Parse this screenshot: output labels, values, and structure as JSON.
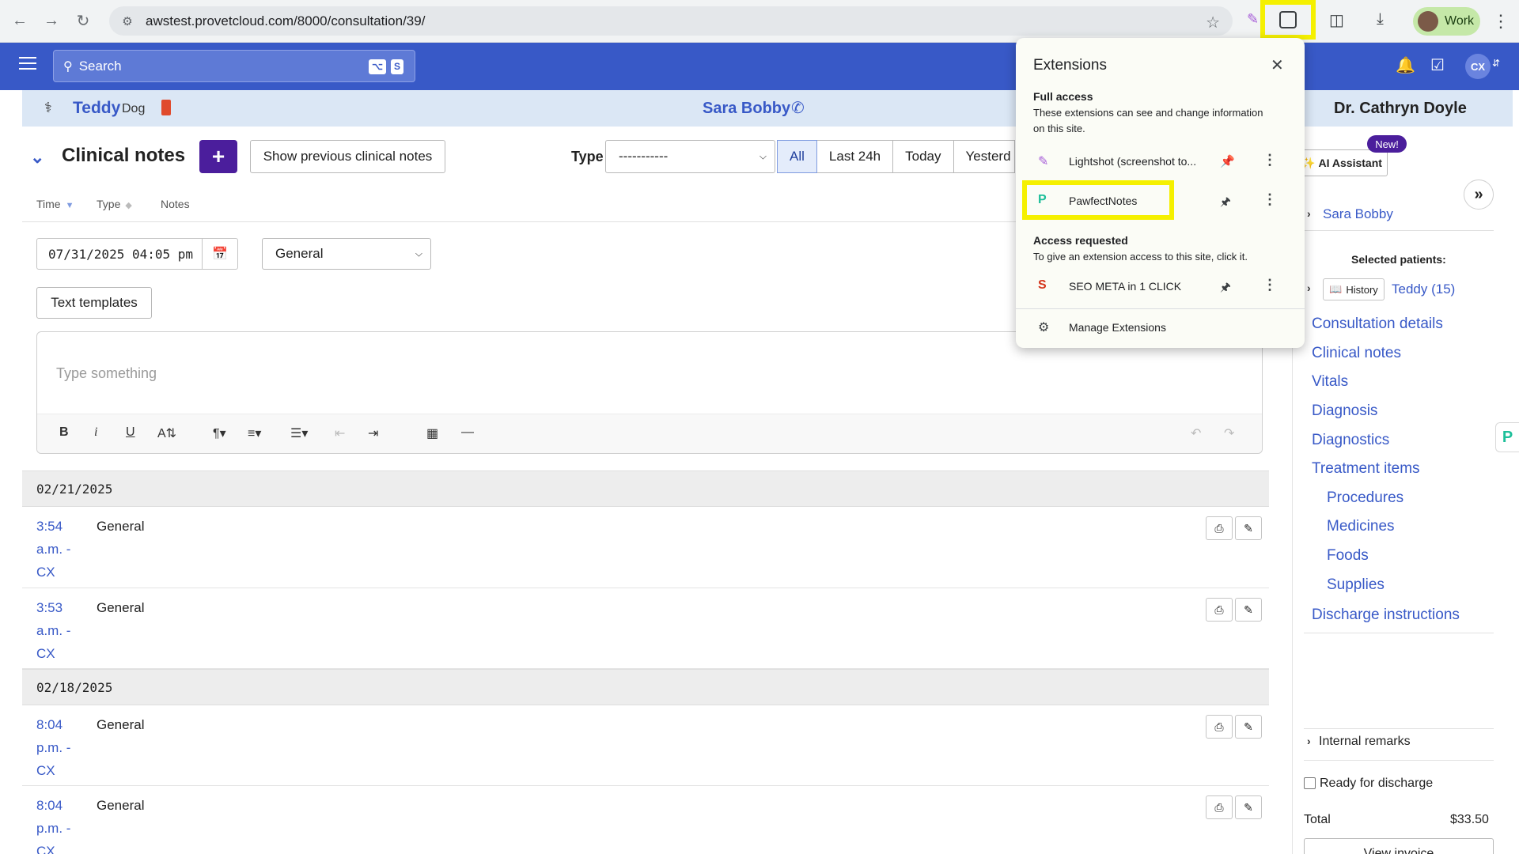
{
  "browser": {
    "url": "awstest.provetcloud.com/8000/consultation/39/",
    "profile_label": "Work"
  },
  "appbar": {
    "search_placeholder": "Search",
    "shortcut_keys": [
      "⌥",
      "S"
    ],
    "user_initials": "CX"
  },
  "banner": {
    "patient_name": "Teddy",
    "patient_species": "Dog",
    "owner_name": "Sara Bobby",
    "doctor_name": "Dr. Cathryn Doyle"
  },
  "clinical_notes": {
    "title": "Clinical notes",
    "add_label": "+",
    "show_previous_label": "Show previous clinical notes",
    "type_label": "Type",
    "type_select_value": "-----------",
    "range_tabs": [
      "All",
      "Last 24h",
      "Today",
      "Yesterd"
    ],
    "range_active": "All",
    "columns": {
      "time": "Time",
      "type": "Type",
      "notes": "Notes"
    },
    "editor": {
      "datetime_value": "07/31/2025 04:05 pm",
      "category_value": "General",
      "text_templates_label": "Text templates",
      "placeholder": "Type something"
    },
    "groups": [
      {
        "date": "02/21/2025",
        "notes": [
          {
            "time": [
              "3:54",
              "a.m. -",
              "CX"
            ],
            "type": "General"
          },
          {
            "time": [
              "3:53",
              "a.m. -",
              "CX"
            ],
            "type": "General"
          }
        ]
      },
      {
        "date": "02/18/2025",
        "notes": [
          {
            "time": [
              "8:04",
              "p.m. -",
              "CX"
            ],
            "type": "General"
          },
          {
            "time": [
              "8:04",
              "p.m. -",
              "CX"
            ],
            "type": "General"
          }
        ]
      }
    ]
  },
  "sidebar": {
    "ai_assistant_label": "AI Assistant",
    "new_badge": "New!",
    "client_name": "Sara Bobby",
    "selected_patients_label": "Selected patients:",
    "history_label": "History",
    "patient_link": "Teddy (15)",
    "nav": [
      "Consultation details",
      "Clinical notes",
      "Vitals",
      "Diagnosis",
      "Diagnostics",
      "Treatment items"
    ],
    "treatment_sub": [
      "Procedures",
      "Medicines",
      "Foods",
      "Supplies"
    ],
    "discharge_label": "Discharge instructions",
    "internal_remarks_label": "Internal remarks",
    "ready_for_discharge_label": "Ready for discharge",
    "total_label": "Total",
    "total_value": "$33.50",
    "view_invoice_label": "View invoice"
  },
  "extensions_popup": {
    "title": "Extensions",
    "full_access_heading": "Full access",
    "full_access_desc": "These extensions can see and change information on this site.",
    "full_access_items": [
      "Lightshot (screenshot to...",
      "PawfectNotes"
    ],
    "access_requested_heading": "Access requested",
    "access_requested_desc": "To give an extension access to this site, click it.",
    "access_requested_items": [
      "SEO META in 1 CLICK"
    ],
    "manage_label": "Manage Extensions"
  },
  "colors": {
    "brand_blue": "#3859c7",
    "add_button_purple": "#4b1e9c",
    "highlight_yellow": "#f5f000",
    "banner_bg": "#dbe7f5"
  }
}
